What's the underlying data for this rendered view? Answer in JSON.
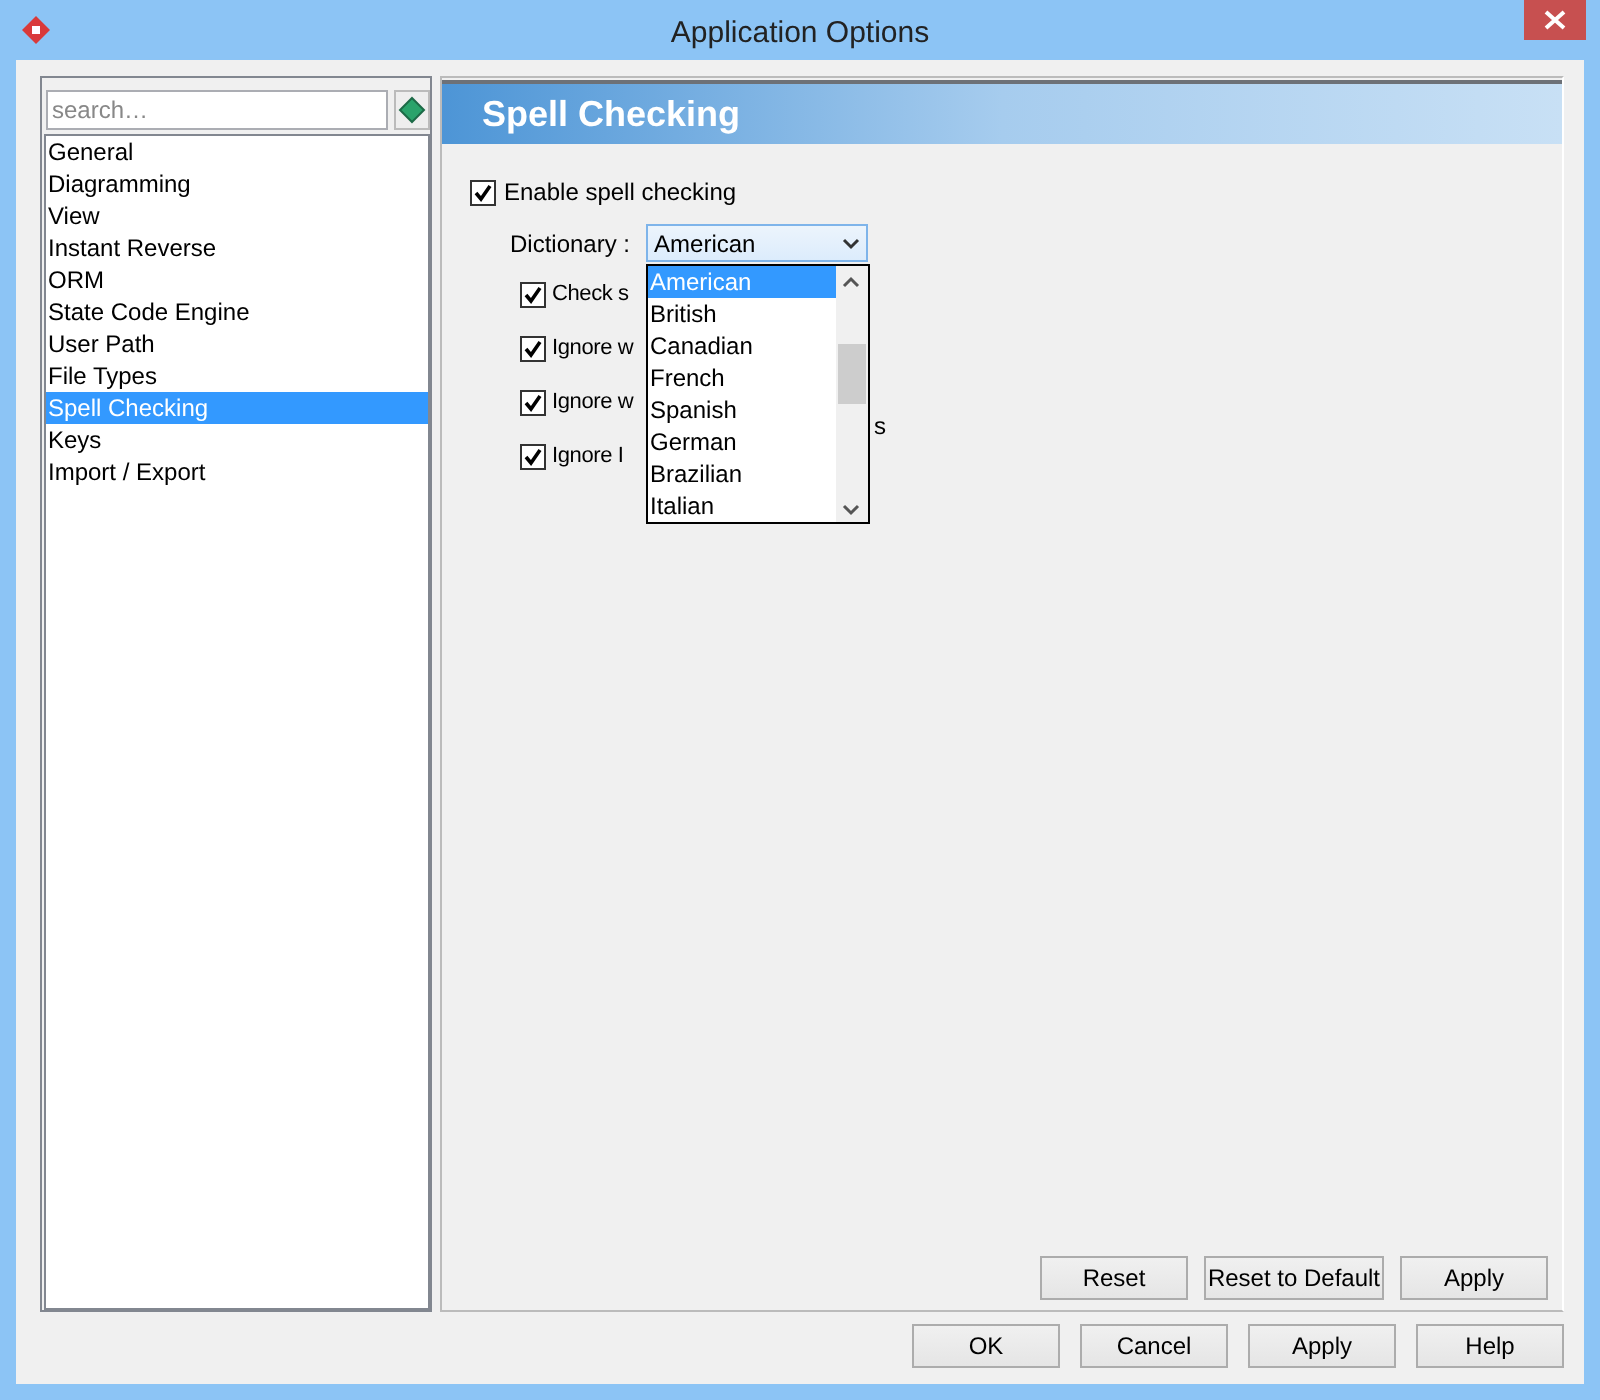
{
  "window": {
    "title": "Application Options"
  },
  "sidebar": {
    "search": {
      "placeholder": "search…"
    },
    "items": [
      {
        "label": "General",
        "selected": false
      },
      {
        "label": "Diagramming",
        "selected": false
      },
      {
        "label": "View",
        "selected": false
      },
      {
        "label": "Instant Reverse",
        "selected": false
      },
      {
        "label": "ORM",
        "selected": false
      },
      {
        "label": "State Code Engine",
        "selected": false
      },
      {
        "label": "User Path",
        "selected": false
      },
      {
        "label": "File Types",
        "selected": false
      },
      {
        "label": "Spell Checking",
        "selected": true
      },
      {
        "label": "Keys",
        "selected": false
      },
      {
        "label": "Import / Export",
        "selected": false
      }
    ]
  },
  "panel": {
    "title": "Spell Checking",
    "enable": {
      "label": "Enable spell checking",
      "checked": true
    },
    "dictionary": {
      "label": "Dictionary :",
      "value": "American",
      "options": [
        {
          "label": "American",
          "selected": true
        },
        {
          "label": "British",
          "selected": false
        },
        {
          "label": "Canadian",
          "selected": false
        },
        {
          "label": "French",
          "selected": false
        },
        {
          "label": "Spanish",
          "selected": false
        },
        {
          "label": "German",
          "selected": false
        },
        {
          "label": "Brazilian",
          "selected": false
        },
        {
          "label": "Italian",
          "selected": false
        }
      ]
    },
    "options": [
      {
        "label": "Check s",
        "checked": true
      },
      {
        "label": "Ignore w",
        "checked": true
      },
      {
        "label": "Ignore w",
        "checked": true
      },
      {
        "label": "Ignore I",
        "tail": "s",
        "checked": true
      }
    ],
    "buttons": [
      "Reset",
      "Reset to Default",
      "Apply"
    ]
  },
  "footer_buttons": [
    "OK",
    "Cancel",
    "Apply",
    "Help"
  ]
}
